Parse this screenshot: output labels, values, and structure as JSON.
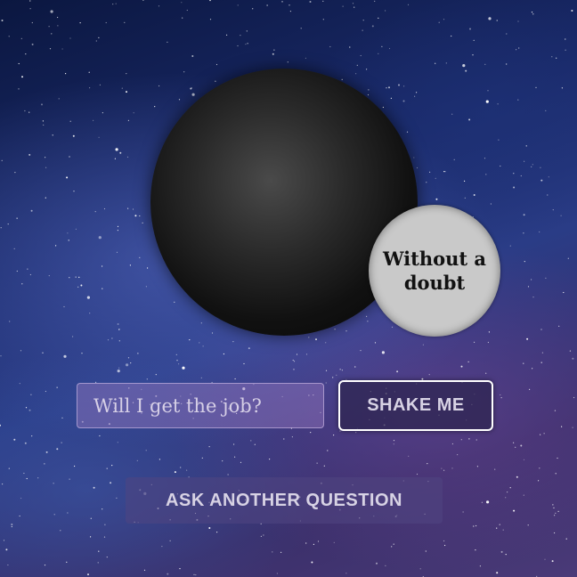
{
  "magic_ball": {
    "answer": "Without a doubt"
  },
  "question": {
    "value": "",
    "placeholder": "Will I get the job?"
  },
  "buttons": {
    "shake_label": "SHAKE ME",
    "ask_another_label": "ASK ANOTHER QUESTION"
  },
  "colors": {
    "ball": "#111111",
    "answer_window": "#c9c9c9",
    "button_text": "#d7d2e4",
    "shake_border": "#ffffff"
  }
}
